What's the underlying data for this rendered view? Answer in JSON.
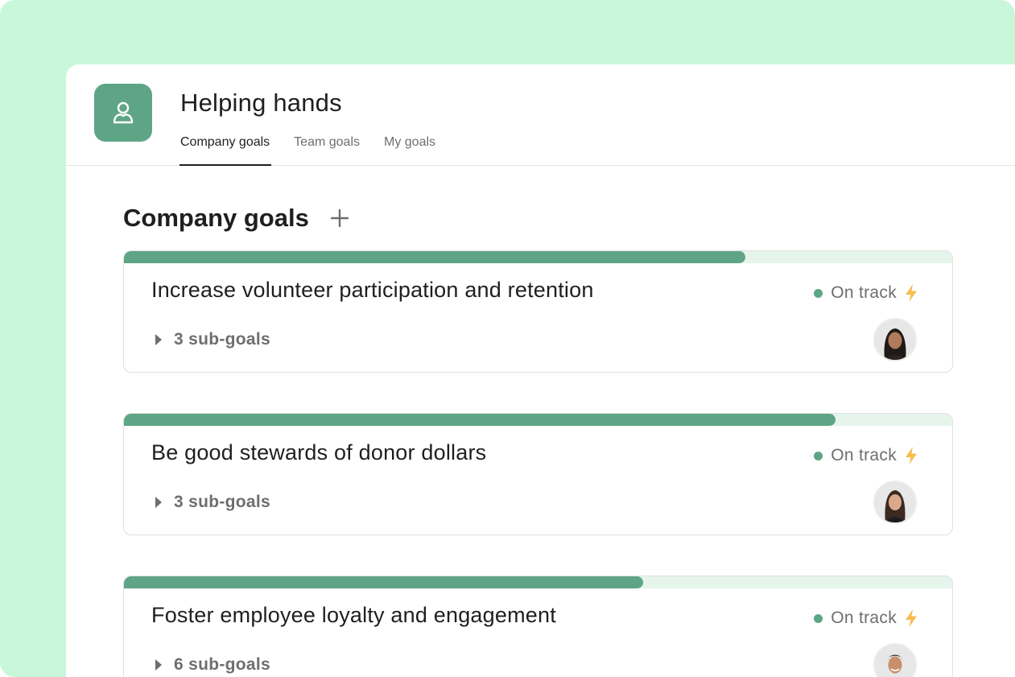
{
  "project": {
    "title": "Helping hands",
    "icon": "hands-icon",
    "accent": "#5ea585",
    "backdrop": "#c9f7da"
  },
  "tabs": [
    {
      "label": "Company goals",
      "active": true
    },
    {
      "label": "Team goals",
      "active": false
    },
    {
      "label": "My goals",
      "active": false
    }
  ],
  "section": {
    "title": "Company goals",
    "add_icon": "plus-icon"
  },
  "goals": [
    {
      "title": "Increase volunteer participation and retention",
      "subgoals": "3 sub-goals",
      "status": "On track",
      "status_color": "#5ea585",
      "progress": 0.75,
      "owner_avatar": "avatar-woman-dark-hair"
    },
    {
      "title": "Be good stewards of donor dollars",
      "subgoals": "3 sub-goals",
      "status": "On track",
      "status_color": "#5ea585",
      "progress": 0.859,
      "owner_avatar": "avatar-woman-brown-hair"
    },
    {
      "title": "Foster employee loyalty and engagement",
      "subgoals": "6 sub-goals",
      "status": "On track",
      "status_color": "#5ea585",
      "progress": 0.627,
      "owner_avatar": "avatar-man-smiling"
    }
  ]
}
